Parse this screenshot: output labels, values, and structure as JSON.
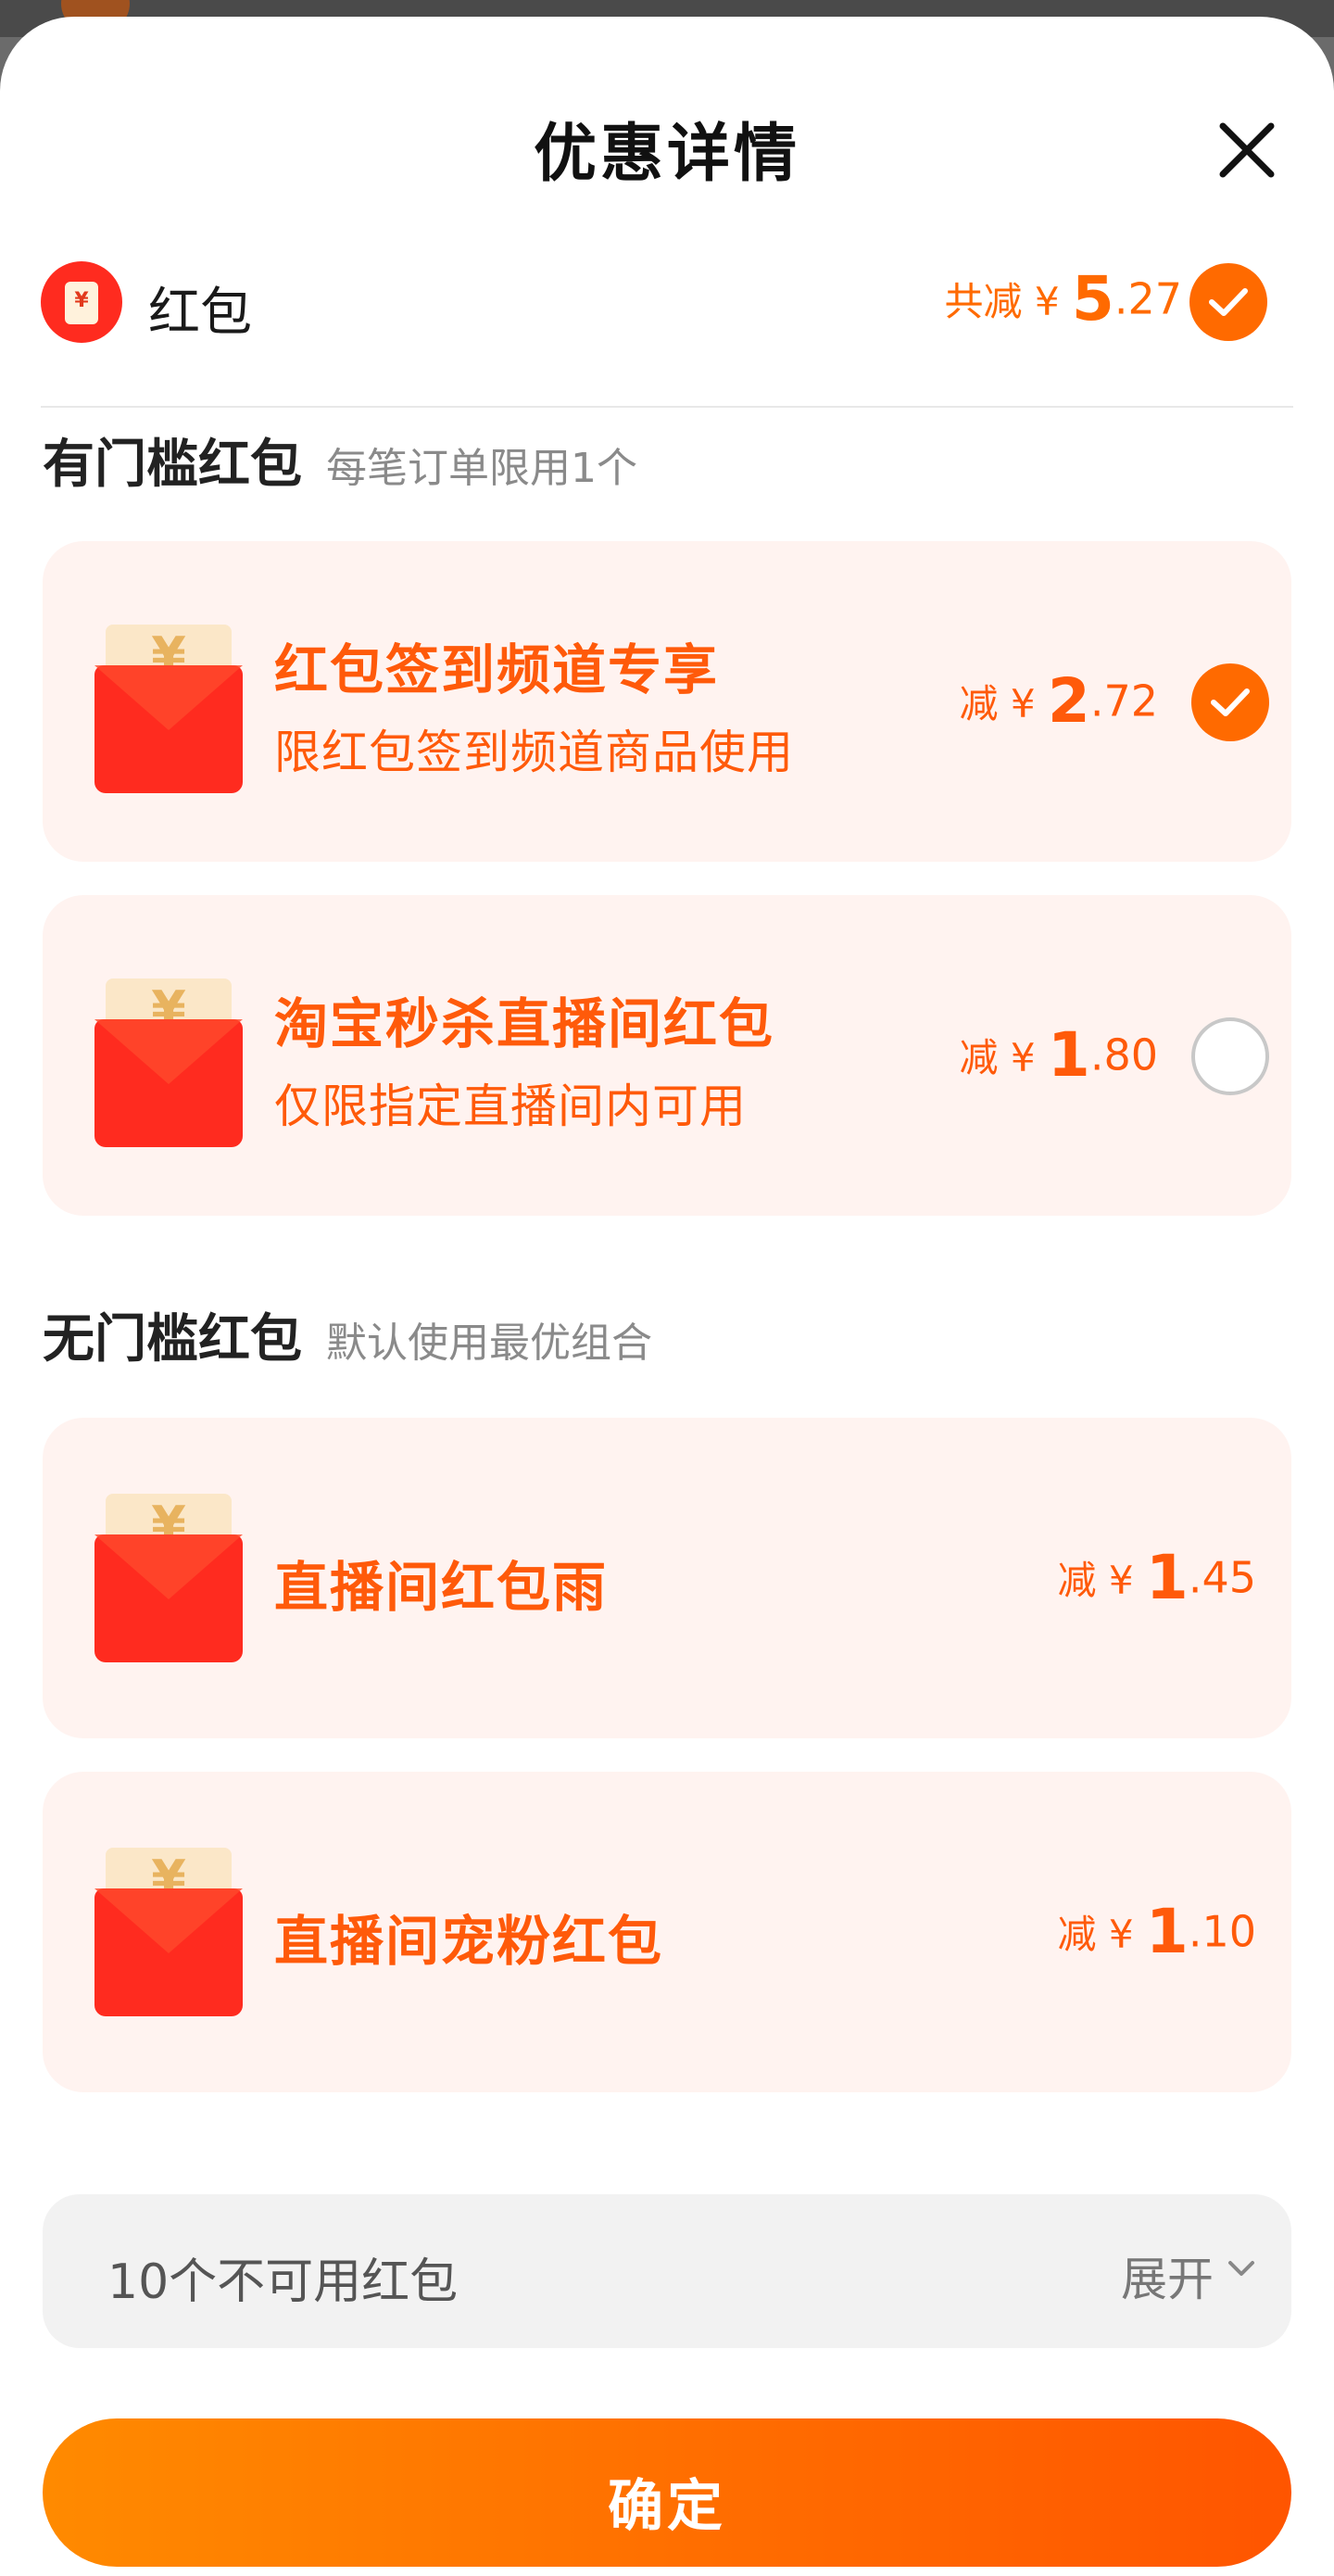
{
  "header": {
    "title": "优惠详情"
  },
  "summary": {
    "label": "红包",
    "badge_yen": "¥",
    "amount_prefix": "共减 ¥ ",
    "amount_int": "5",
    "amount_frac": ".27",
    "checked": true
  },
  "threshold_section": {
    "title": "有门槛红包",
    "subtitle": "每笔订单限用1个",
    "items": [
      {
        "title": "红包签到频道专享",
        "desc": "限红包签到频道商品使用",
        "amount_prefix": "减 ¥ ",
        "amount_int": "2",
        "amount_frac": ".72",
        "checked": true
      },
      {
        "title": "淘宝秒杀直播间红包",
        "desc": "仅限指定直播间内可用",
        "amount_prefix": "减 ¥ ",
        "amount_int": "1",
        "amount_frac": ".80",
        "checked": false
      }
    ]
  },
  "no_threshold_section": {
    "title": "无门槛红包",
    "subtitle": "默认使用最优组合",
    "items": [
      {
        "title": "直播间红包雨",
        "amount_prefix": "减 ¥ ",
        "amount_int": "1",
        "amount_frac": ".45"
      },
      {
        "title": "直播间宠粉红包",
        "amount_prefix": "减 ¥ ",
        "amount_int": "1",
        "amount_frac": ".10"
      }
    ]
  },
  "unavailable": {
    "label": "10个不可用红包",
    "expand_label": "展开"
  },
  "confirm": {
    "label": "确定"
  },
  "envelope_yen": "¥",
  "colors": {
    "accent": "#ff6a00",
    "card_bg": "#fff3f0",
    "packet_red": "#ff2b1f"
  }
}
